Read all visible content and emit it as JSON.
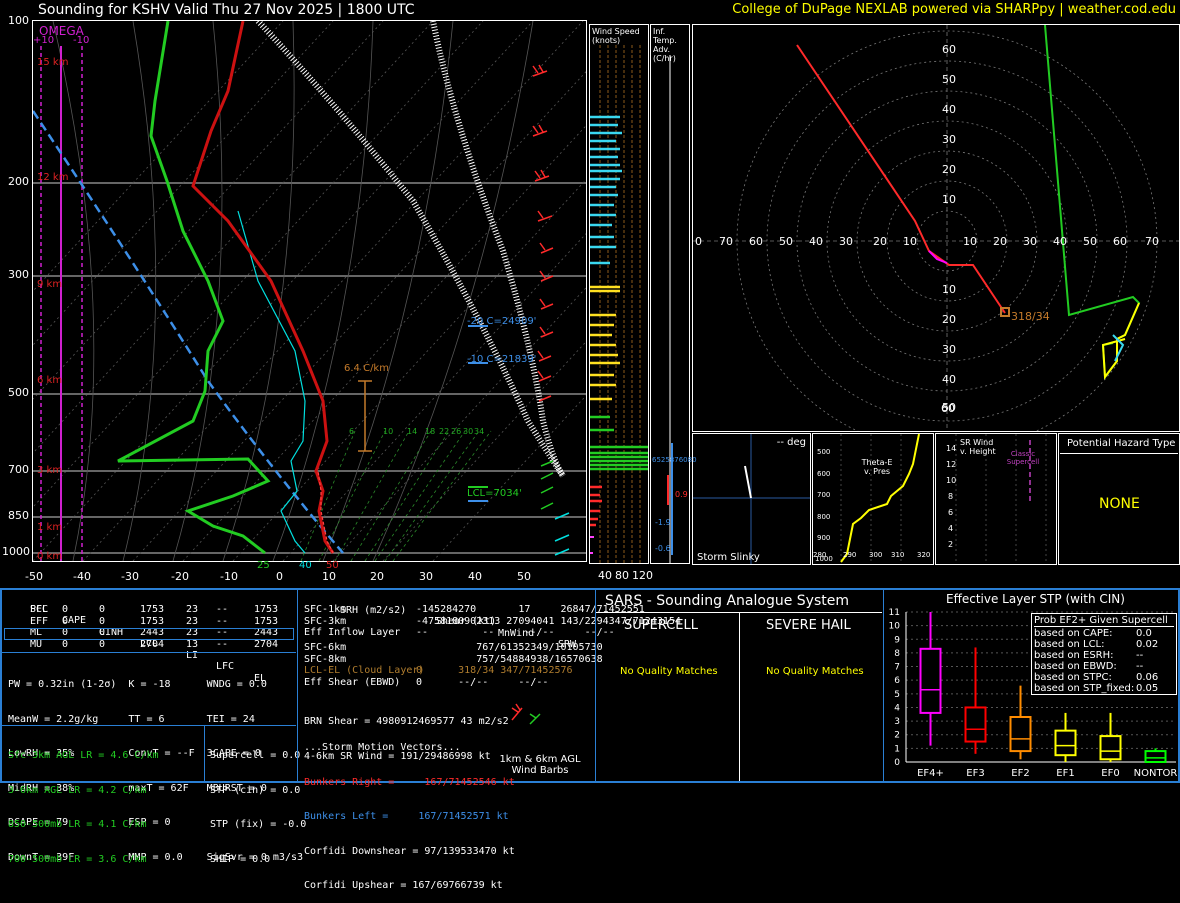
{
  "header": {
    "title": "Sounding for KSHV Valid  Thu 27 Nov 2025 | 1800 UTC",
    "credit": "College of DuPage NEXLAB powered via SHARPpy | weather.cod.edu"
  },
  "skewt": {
    "omega_label": "OMEGA",
    "omega_ticks": [
      "+10",
      "-10"
    ],
    "pressure_ticks": [
      "100",
      "200",
      "300",
      "500",
      "700",
      "850",
      "1000"
    ],
    "height_labels": [
      "15 km",
      "12 km",
      "9 km",
      "6 km",
      "3 km",
      "1 km",
      "0 km"
    ],
    "temp_ticks": [
      "-50",
      "-40",
      "-30",
      "-20",
      "-10",
      "0",
      "10",
      "20",
      "30",
      "40",
      "50"
    ],
    "mixing_ratio_labels": [
      "6",
      "10",
      "14",
      "18",
      "22",
      "26",
      "30",
      "34"
    ],
    "bottom_labels": [
      "25",
      "40",
      "50"
    ],
    "annotations": {
      "lapse": "6.4 C/km",
      "m20": "-20 C=24909'",
      "m10": "-10 C=21839'",
      "lcl": "LCL=7034'"
    }
  },
  "wind_speed_panel": {
    "title": "Wind Speed (knots)",
    "ticks": [
      "40",
      "80",
      "120"
    ]
  },
  "temp_adv_panel": {
    "title": "Inf. Temp. Adv.(C/hr)",
    "values": [
      "6525876080",
      "0.9",
      "-1.9",
      "-0.6"
    ]
  },
  "hodograph": {
    "rings_y": [
      "60",
      "50",
      "40",
      "30",
      "20",
      "10"
    ],
    "rings_x": [
      "0",
      "70",
      "60",
      "50",
      "40",
      "30",
      "20",
      "10",
      "10",
      "20",
      "30",
      "40",
      "50",
      "60",
      "70"
    ],
    "rings_y_low": [
      "10",
      "20",
      "30",
      "40",
      "50",
      "60"
    ],
    "storm_label": "318/34"
  },
  "storm_slinky": {
    "title": "-- deg",
    "label": "Storm Slinky"
  },
  "theta_panel": {
    "label": "Theta-E v. Pres",
    "y_ticks": [
      "500",
      "600",
      "700",
      "800",
      "900",
      "1000"
    ],
    "x_ticks": [
      "280",
      "290",
      "300",
      "310",
      "320"
    ]
  },
  "srwind_panel": {
    "label": "SR Wind v. Height",
    "classic": "Classic Supercell",
    "y_ticks": [
      "14",
      "12",
      "10",
      "8",
      "6",
      "4",
      "2"
    ]
  },
  "hazard": {
    "title": "Potential Hazard Type",
    "value": "NONE"
  },
  "parcels": {
    "headers": [
      "PCL",
      "CAPE",
      "CINH",
      "LCL",
      "LI",
      "LFC",
      "EL"
    ],
    "rows": [
      [
        "SFC",
        "0",
        "0",
        "1753",
        "23",
        "--",
        "1753"
      ],
      [
        "EFF",
        "0",
        "0",
        "1753",
        "23",
        "--",
        "1753"
      ],
      [
        "ML",
        "0",
        "0",
        "2443",
        "23",
        "--",
        "2443"
      ],
      [
        "MU",
        "0",
        "0",
        "2704",
        "13",
        "--",
        "2704"
      ]
    ]
  },
  "indices": [
    "PW = 0.32in (1-2σ)  K = -18      WNDG = 0.0",
    "MeanW = 2.2g/kg     TT = 6       TEI = 24",
    "LowRH = 35%         ConvT = --F  3CAPE = 0",
    "MidRH = 38%         maxT = 62F   MBURST = 0",
    "DCAPE = 79          ESP = 0",
    "DownT = 39F         MMP = 0.0    SigSvr = 0 m3/s3"
  ],
  "lapse_rates": [
    "Sfc-3km AGL LR = 4.6 C/km",
    "3-6km AGL LR = 4.2 C/km",
    "850-500mb LR = 4.1 C/km",
    "700-500mb LR = 3.6 C/km"
  ],
  "composites": [
    "Supercell = 0.0",
    "STP (cin) = 0.0",
    "STP (fix) = -0.0",
    "SHIP = 0.0"
  ],
  "kinematics": {
    "headers": [
      "SRH (m2/s2)",
      "Shear (kt)",
      "MnWind",
      "SRW"
    ],
    "rows": [
      {
        "label": "SFC-1km",
        "text": "-145284270       17     26847/71452551",
        "color": "#ffffff"
      },
      {
        "label": "SFC-3km",
        "text": "-4758180902313 27094041 143/2294347/71243154",
        "color": "#ffffff"
      },
      {
        "label": "Eff Inflow Layer",
        "text": "--         --     --/--     --/--",
        "color": "#ffffff"
      },
      {
        "label": "SFC-6km",
        "text": "          767/61352349/10105730",
        "color": "#ffffff"
      },
      {
        "label": "SFC-8km",
        "text": "          757/54884938/16570638",
        "color": "#ffffff"
      },
      {
        "label": "LCL-EL (Cloud Layer)",
        "text": "0      318/34 347/71452576",
        "color": "#b07d2e"
      },
      {
        "label": "Eff Shear (EBWD)",
        "text": "0      --/--     --/--",
        "color": "#ffffff"
      }
    ],
    "brn": "BRN Shear = 4980912469577 43 m2/s2",
    "srw": "4-6km SR Wind = 191/29486998 kt",
    "storm_title": "...Storm Motion Vectors...",
    "bunkers_right": "Bunkers Right =     167/71452546 kt",
    "bunkers_left": "Bunkers Left =     167/71452571 kt",
    "corfidi_down": "Corfidi Downshear = 97/139533470 kt",
    "corfidi_up": "Corfidi Upshear = 167/69766739 kt",
    "barbs_label": "1km & 6km AGL Wind Barbs"
  },
  "sars": {
    "title": "SARS - Sounding Analogue System",
    "supercell": "SUPERCELL",
    "hail": "SEVERE HAIL",
    "no_match_1": "No Quality Matches",
    "no_match_2": "No Quality Matches"
  },
  "stp": {
    "title": "Effective Layer STP (with CIN)",
    "prob_title": "Prob EF2+ Given Supercell",
    "prob_rows": [
      [
        "based on CAPE:",
        "0.0"
      ],
      [
        "based on LCL:",
        "0.02"
      ],
      [
        "based on ESRH:",
        "--"
      ],
      [
        "based on EBWD:",
        "--"
      ],
      [
        "based on STPC:",
        "0.06"
      ],
      [
        "based on STP_fixed:",
        "0.05"
      ]
    ]
  },
  "chart_data": {
    "type": "box",
    "title": "Effective Layer STP (with CIN)",
    "categories": [
      "EF4+",
      "EF3",
      "EF2",
      "EF1",
      "EF0",
      "NONTOR"
    ],
    "colors": [
      "#ff00ff",
      "#ff0000",
      "#ff8c00",
      "#ffff00",
      "#ffff00",
      "#00ff00"
    ],
    "y_ticks": [
      "0",
      "1",
      "2",
      "3",
      "4",
      "5",
      "6",
      "7",
      "8",
      "9",
      "10",
      "11"
    ],
    "ylim": [
      0,
      11
    ],
    "boxes": [
      {
        "low": 1.2,
        "q1": 3.6,
        "median": 5.3,
        "q3": 8.3,
        "high": 11.0
      },
      {
        "low": 0.6,
        "q1": 1.5,
        "median": 2.4,
        "q3": 4.0,
        "high": 8.4
      },
      {
        "low": 0.2,
        "q1": 0.8,
        "median": 1.7,
        "q3": 3.3,
        "high": 5.6
      },
      {
        "low": 0.0,
        "q1": 0.5,
        "median": 1.2,
        "q3": 2.3,
        "high": 3.6
      },
      {
        "low": 0.0,
        "q1": 0.2,
        "median": 0.8,
        "q3": 1.9,
        "high": 3.6
      },
      {
        "low": 0.0,
        "q1": 0.0,
        "median": 0.3,
        "q3": 0.8,
        "high": 1.0
      }
    ]
  }
}
